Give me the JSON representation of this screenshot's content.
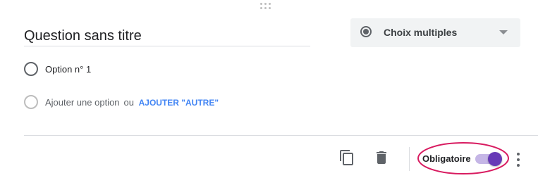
{
  "question": {
    "title": "Question sans titre"
  },
  "type_select": {
    "selected": "Choix multiples",
    "icon": "radio-button-icon"
  },
  "options": [
    {
      "label": "Option n° 1"
    }
  ],
  "add_option": {
    "label": "Ajouter une option",
    "or": "ou",
    "add_other": "AJOUTER \"AUTRE\""
  },
  "footer": {
    "duplicate_icon": "copy-icon",
    "delete_icon": "trash-icon",
    "required_label": "Obligatoire",
    "required": true,
    "more_icon": "more-vert-icon"
  },
  "colors": {
    "accent": "#673ab7",
    "link": "#4285f4",
    "highlight": "#d81b60"
  }
}
